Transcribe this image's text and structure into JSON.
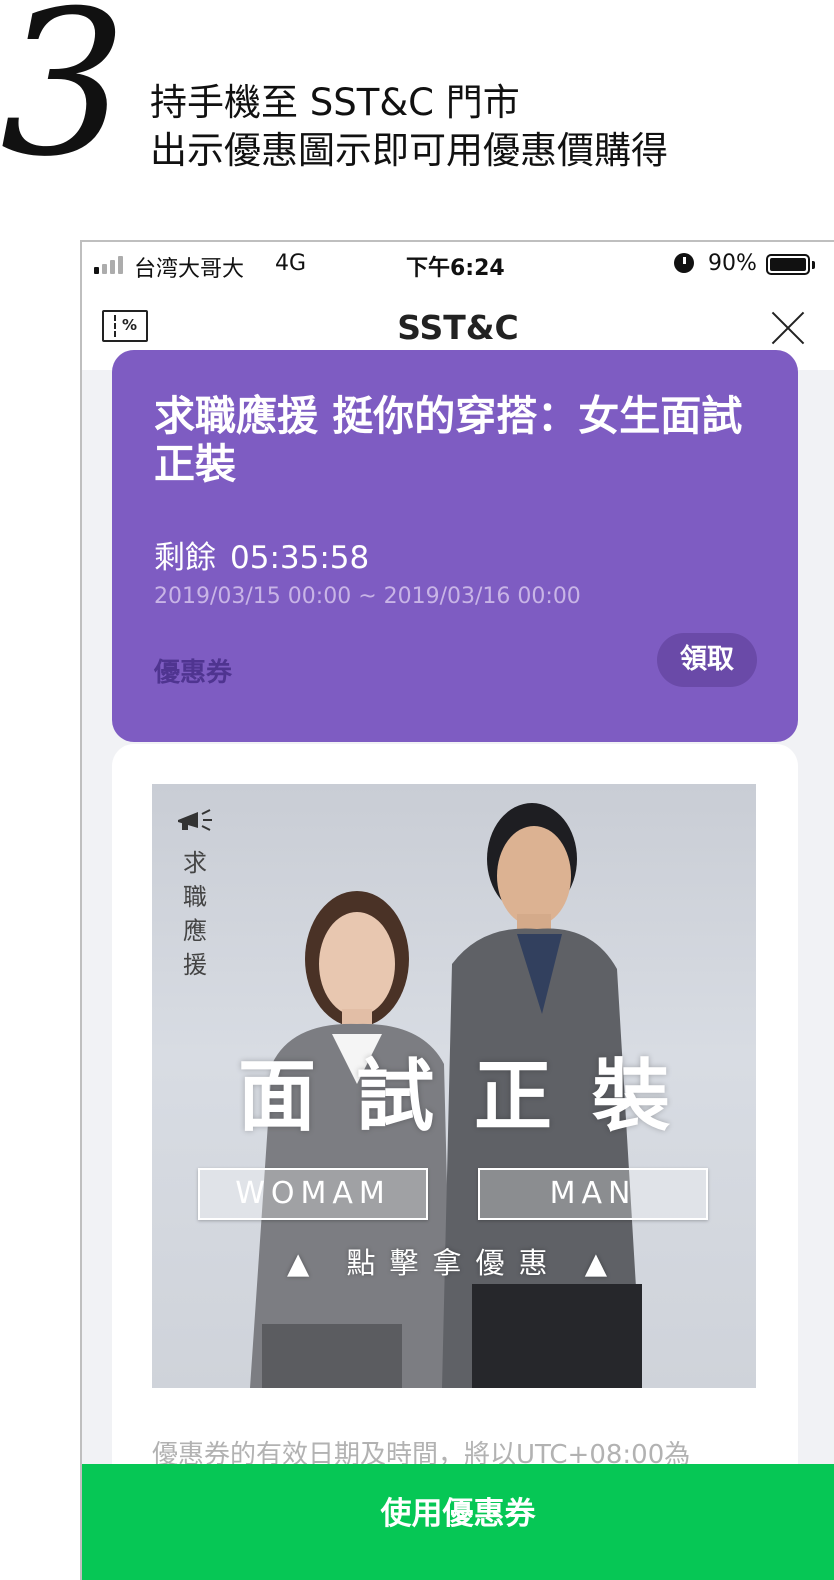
{
  "step": {
    "number": "3",
    "line1": "持手機至 SST&C 門市",
    "line2": "出示優惠圖示即可用優惠價購得"
  },
  "statusbar": {
    "carrier": "台湾大哥大",
    "network": "4G",
    "time": "下午6:24",
    "battery": "90%",
    "signal_bars": 4,
    "signal_active": 1
  },
  "navbar": {
    "coupon_icon_symbol": "%",
    "title": "SST&C"
  },
  "coupon": {
    "title": "求職應援 挺你的穿搭：女生面試正裝",
    "remaining_label": "剩餘",
    "remaining_time": "05:35:58",
    "date_range": "2019/03/15 00:00 ~ 2019/03/16 00:00",
    "type_label": "優惠券",
    "claim_label": "領取",
    "background_color": "#7e5cc2"
  },
  "banner": {
    "vertical_text": "求職應援",
    "headline": "面試正裝",
    "women_label": "WOMAM",
    "men_label": "MAN",
    "cta": "▲ 點擊拿優惠 ▲"
  },
  "notice": "優惠券的有效日期及時間，將以UTC+08:00為",
  "use_button": {
    "label": "使用優惠券",
    "color": "#06c755"
  }
}
